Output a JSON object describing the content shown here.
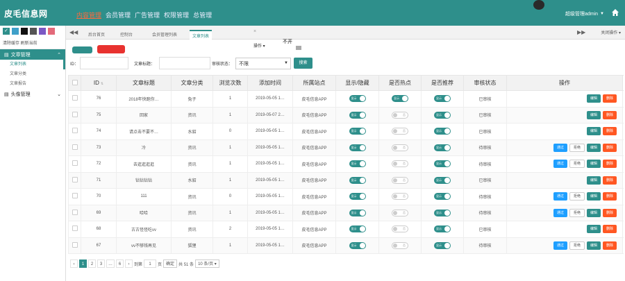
{
  "app": {
    "brand": "皮毛信息网",
    "nav": [
      {
        "label": "内容管理",
        "active": true
      },
      {
        "label": "会员管理",
        "active": false
      },
      {
        "label": "广告管理",
        "active": false
      },
      {
        "label": "权限管理",
        "active": false
      },
      {
        "label": "总管理",
        "active": false
      }
    ],
    "user": "超级管理admin"
  },
  "sidebar": {
    "swatches": [
      "#2e8f8b",
      "#3fa0c9",
      "#111111",
      "#555555",
      "#7b58c4",
      "#e36a7a"
    ],
    "links": "清除缓存 刷新当前",
    "menus": [
      {
        "label": "文章管理",
        "active": true,
        "children": [
          {
            "label": "文章列表",
            "active": true
          },
          {
            "label": "文章分类",
            "active": false
          },
          {
            "label": "文章报告",
            "active": false
          }
        ]
      },
      {
        "label": "头像管理",
        "active": false,
        "children": []
      }
    ]
  },
  "tabs": {
    "items": [
      {
        "label": "后台首页",
        "active": false
      },
      {
        "label": "控制台",
        "active": false
      },
      {
        "label": "会员管理列表",
        "active": false
      },
      {
        "label": "文章列表",
        "active": true
      }
    ],
    "ops": "关闭操作"
  },
  "toolbar": {
    "op_label": "操作",
    "op_text": "不开"
  },
  "search": {
    "id_label": "ID：",
    "title_label": "文章标题：",
    "status_label": "审核状态：",
    "status_value": "不限",
    "submit": "搜索"
  },
  "table": {
    "columns": [
      "ID",
      "文章标题",
      "文章分类",
      "浏览次数",
      "添加时间",
      "所属站点",
      "显示/隐藏",
      "是否热点",
      "是否推荐",
      "审核状态",
      "操作"
    ],
    "actions": {
      "approve": "通过",
      "reject": "拒绝",
      "edit": "编辑",
      "delete": "删除"
    },
    "switch_on": "显示",
    "switch_off": "否",
    "rows": [
      {
        "id": "76",
        "title": "2018年快跑你…",
        "category": "兔子",
        "views": "1",
        "time": "2019-05-05 1…",
        "site": "皮毛信息APP",
        "show": true,
        "hot": true,
        "rec": true,
        "status": "已审核",
        "pending": false
      },
      {
        "id": "75",
        "title": "回家",
        "category": "资讯",
        "views": "1",
        "time": "2019-05-07 2…",
        "site": "皮毛信息APP",
        "show": true,
        "hot": false,
        "rec": true,
        "status": "已审核",
        "pending": false
      },
      {
        "id": "74",
        "title": "请点击不要不…",
        "category": "水貂",
        "views": "0",
        "time": "2019-05-05 1…",
        "site": "皮毛信息APP",
        "show": true,
        "hot": false,
        "rec": true,
        "status": "已审核",
        "pending": false
      },
      {
        "id": "73",
        "title": "冷",
        "category": "资讯",
        "views": "1",
        "time": "2019-05-05 1…",
        "site": "皮毛信息APP",
        "show": true,
        "hot": false,
        "rec": true,
        "status": "待审核",
        "pending": true
      },
      {
        "id": "72",
        "title": "去逛逛逛逛",
        "category": "资讯",
        "views": "1",
        "time": "2019-05-05 1…",
        "site": "皮毛信息APP",
        "show": true,
        "hot": false,
        "rec": true,
        "status": "待审核",
        "pending": true
      },
      {
        "id": "71",
        "title": "钻钻钻钻",
        "category": "水貂",
        "views": "1",
        "time": "2019-05-05 1…",
        "site": "皮毛信息APP",
        "show": true,
        "hot": false,
        "rec": true,
        "status": "已审核",
        "pending": false
      },
      {
        "id": "70",
        "title": "111",
        "category": "资讯",
        "views": "0",
        "time": "2019-05-05 1…",
        "site": "皮毛信息APP",
        "show": true,
        "hot": false,
        "rec": true,
        "status": "待审核",
        "pending": true
      },
      {
        "id": "69",
        "title": "哈哈",
        "category": "资讯",
        "views": "1",
        "time": "2019-05-05 1…",
        "site": "皮毛信息APP",
        "show": true,
        "hot": false,
        "rec": true,
        "status": "待审核",
        "pending": true
      },
      {
        "id": "68",
        "title": "古古怪怪吃vv",
        "category": "资讯",
        "views": "2",
        "time": "2019-05-05 1…",
        "site": "皮毛信息APP",
        "show": true,
        "hot": false,
        "rec": true,
        "status": "已审核",
        "pending": false
      },
      {
        "id": "67",
        "title": "vv不够钱再见",
        "category": "狐狸",
        "views": "1",
        "time": "2019-05-05 1…",
        "site": "皮毛信息APP",
        "show": true,
        "hot": false,
        "rec": true,
        "status": "待审核",
        "pending": true
      }
    ]
  },
  "pager": {
    "prev": "‹",
    "pages": [
      "1",
      "2",
      "3",
      "…",
      "6"
    ],
    "next": "›",
    "goto_label": "到第",
    "goto_value": "1",
    "page_suffix": "页",
    "confirm": "确定",
    "total": "共 51 条",
    "per_page": "10 条/页"
  }
}
